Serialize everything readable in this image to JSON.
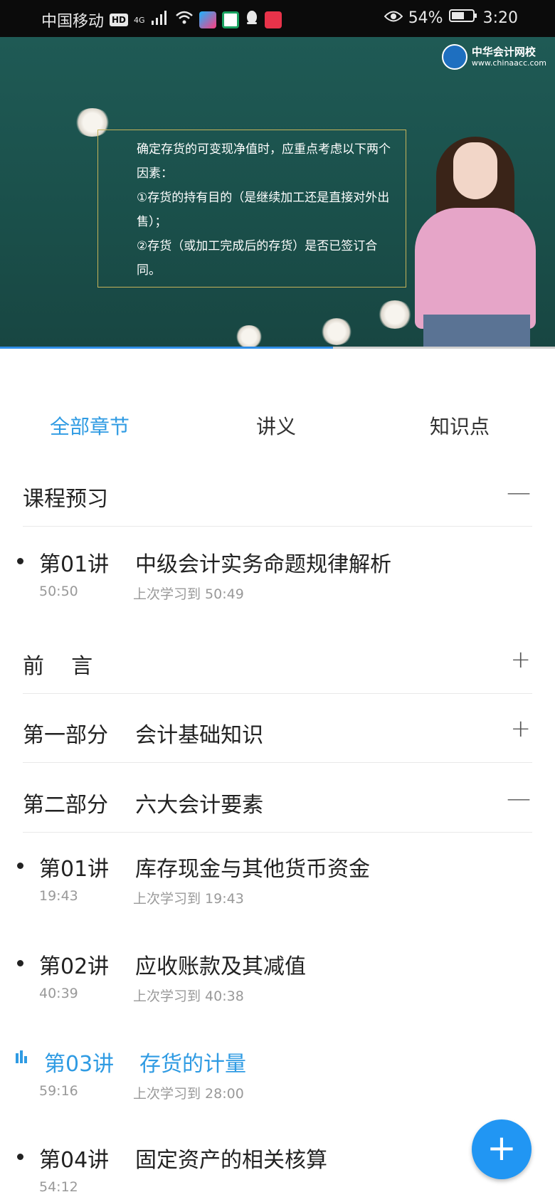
{
  "status_bar": {
    "carrier": "中国移动",
    "hd_badge": "HD",
    "network": "4G",
    "battery": "54%",
    "time": "3:20",
    "icons": [
      "signal-icon",
      "wifi-icon",
      "youku-icon",
      "app-icon",
      "qq-icon",
      "app-icon",
      "eye-icon",
      "battery-icon"
    ]
  },
  "video": {
    "logo_cn": "中华会计网校",
    "logo_url": "www.chinaacc.com",
    "slide_lines": [
      "确定存货的可变现净值时，应重点考虑以下两个因素：",
      "①存货的持有目的（是继续加工还是直接对外出售）；",
      "②存货（或加工完成后的存货）是否已签订合同。"
    ],
    "progress": 0.6
  },
  "tabs": [
    {
      "label": "全部章节",
      "active": true
    },
    {
      "label": "讲义",
      "active": false
    },
    {
      "label": "知识点",
      "active": false
    }
  ],
  "sections": [
    {
      "title": "课程预习",
      "toggle": "—"
    },
    {
      "title": "前    言",
      "toggle": "+"
    },
    {
      "title": "第一部分    会计基础知识",
      "toggle": "+"
    },
    {
      "title": "第二部分    六大会计要素",
      "toggle": "—"
    }
  ],
  "lessons": [
    {
      "num": "第01讲",
      "title": "中级会计实务命题规律解析",
      "duration": "50:50",
      "last": "上次学习到 50:49"
    },
    {
      "num": "第01讲",
      "title": "库存现金与其他货币资金",
      "duration": "19:43",
      "last": "上次学习到 19:43"
    },
    {
      "num": "第02讲",
      "title": "应收账款及其减值",
      "duration": "40:39",
      "last": "上次学习到 40:38"
    },
    {
      "num": "第03讲",
      "title": "存货的计量",
      "duration": "59:16",
      "last": "上次学习到 28:00",
      "playing": true
    },
    {
      "num": "第04讲",
      "title": "固定资产的相关核算",
      "duration": "54:12",
      "last": ""
    }
  ],
  "fab": {
    "label": "+"
  },
  "colors": {
    "accent": "#2f9be3",
    "fab": "#2196f3",
    "board": "#1f5a55"
  }
}
